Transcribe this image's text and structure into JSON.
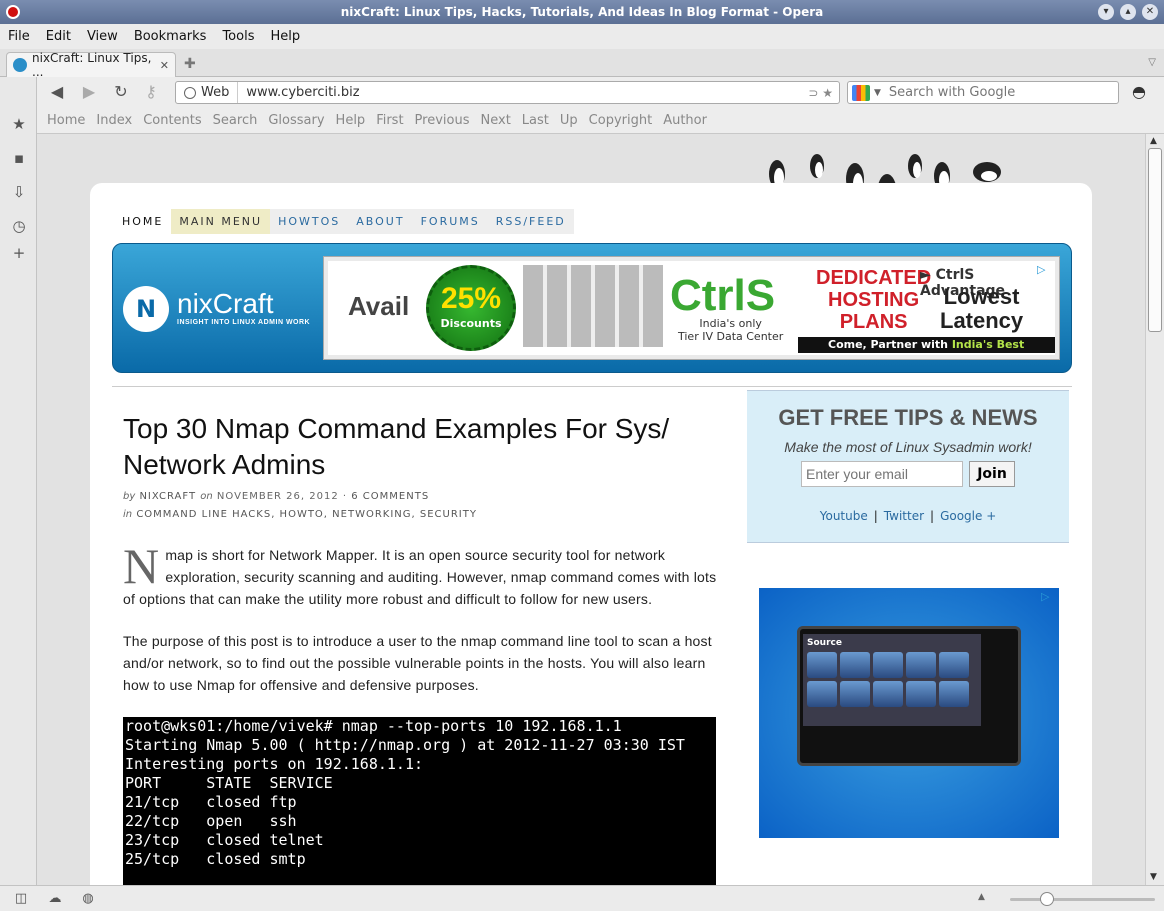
{
  "window": {
    "title": "nixCraft: Linux Tips, Hacks, Tutorials, And Ideas In Blog Format - Opera"
  },
  "menu": [
    "File",
    "Edit",
    "View",
    "Bookmarks",
    "Tools",
    "Help"
  ],
  "tab": {
    "title": "nixCraft: Linux Tips, ..."
  },
  "address": {
    "web_label": "Web",
    "url": "www.cyberciti.biz"
  },
  "search": {
    "placeholder": "Search with Google"
  },
  "navtoolbar": [
    "Home",
    "Index",
    "Contents",
    "Search",
    "Glossary",
    "Help",
    "First",
    "Previous",
    "Next",
    "Last",
    "Up",
    "Copyright",
    "Author"
  ],
  "site": {
    "nav": {
      "home": "HOME",
      "main": "MAIN MENU",
      "howtos": "HOWTOS",
      "about": "ABOUT",
      "forums": "FORUMS",
      "rss": "RSS/FEED"
    },
    "logo": {
      "name": "nixCraft",
      "tagline": "INSIGHT INTO LINUX ADMIN WORK"
    },
    "ad": {
      "avail": "Avail",
      "percent": "25%",
      "discounts": "Discounts",
      "brand": "CtrlS",
      "brand_sub1": "India's only",
      "brand_sub2": "Tier IV Data Center",
      "dedicated1": "DEDICATED",
      "dedicated2": "HOSTING",
      "dedicated3": "PLANS",
      "advantage": "► CtrlS Advantage",
      "lowest1": "Lowest",
      "lowest2": "Latency",
      "strip_a": "Come, Partner with ",
      "strip_b": "India's Best Datacenter"
    }
  },
  "article": {
    "title": "Top 30 Nmap Command Examples For Sys/ Network Admins",
    "by": "by",
    "author": "NIXCRAFT",
    "on": "on",
    "date": "NOVEMBER 26, 2012",
    "comments": "6 COMMENTS",
    "in": "in",
    "categories": "COMMAND LINE HACKS, HOWTO, NETWORKING, SECURITY",
    "dropcap": "N",
    "para1": "map is short for Network Mapper. It is an open source security tool for network exploration, security scanning and auditing. However, nmap command comes with lots of options that can make the utility more robust and difficult to follow for new users.",
    "para2": "The purpose of this post is to introduce a user to the nmap command line tool to scan a host and/or network, so to find out the possible vulnerable points in the hosts. You will also learn how to use Nmap for offensive and defensive purposes.",
    "terminal": [
      "root@wks01:/home/vivek# nmap --top-ports 10 192.168.1.1",
      "",
      "Starting Nmap 5.00 ( http://nmap.org ) at 2012-11-27 03:30 IST",
      "Interesting ports on 192.168.1.1:",
      "PORT     STATE  SERVICE",
      "21/tcp   closed ftp",
      "22/tcp   open   ssh",
      "23/tcp   closed telnet",
      "25/tcp   closed smtp"
    ]
  },
  "sidebar": {
    "heading": "GET FREE TIPS & NEWS",
    "tagline": "Make the most of Linux Sysadmin work!",
    "email_placeholder": "Enter your email",
    "join": "Join",
    "youtube": "Youtube",
    "twitter": "Twitter",
    "googleplus": "Google +",
    "sep": "|"
  },
  "ad2": {
    "source": "Source"
  }
}
